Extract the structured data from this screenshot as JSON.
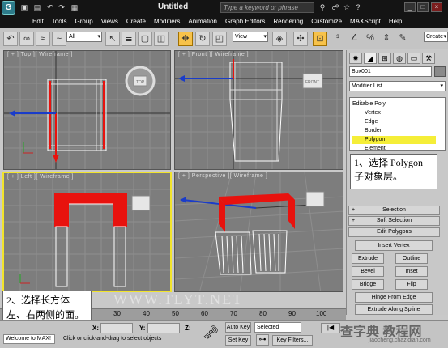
{
  "title": "Untitled",
  "search_placeholder": "Type a keyword or phrase",
  "menu": [
    "Edit",
    "Tools",
    "Group",
    "Views",
    "Create",
    "Modifiers",
    "Animation",
    "Graph Editors",
    "Rendering",
    "Customize",
    "MAXScript",
    "Help"
  ],
  "toolbar": {
    "filter": "All",
    "coord_system": "View",
    "named_set": "Create"
  },
  "viewports": {
    "top": "[ + ] Top ][ Wireframe ]",
    "front": "[ + ] Front ][ Wireframe ]",
    "left": "[ + ] Left ][ Wireframe ]",
    "perspective": "[ + ] Perspective ][ Wireframe ]",
    "viewcube_top": "TOP",
    "viewcube_front": "FRONT"
  },
  "command_panel": {
    "object_name": "Box001",
    "modifier_list": "Modifier List",
    "stack": [
      "Editable Poly",
      "Vertex",
      "Edge",
      "Border",
      "Polygon",
      "Element"
    ],
    "rollouts": [
      "Selection",
      "Soft Selection",
      "Edit Polygons"
    ],
    "buttons": {
      "insert_vertex": "Insert Vertex",
      "extrude": "Extrude",
      "outline": "Outline",
      "bevel": "Bevel",
      "inset": "Inset",
      "bridge": "Bridge",
      "flip": "Flip",
      "hinge": "Hinge From Edge",
      "extrude_spline": "Extrude Along Spline"
    }
  },
  "callouts": {
    "one_a": "1、选择 Polygon",
    "one_b": "子对象层。",
    "two_a": "2、选择长方体",
    "two_b": "左、右两侧的面。"
  },
  "watermark": "WWW.TLYT.NET",
  "time_ticks": [
    "30",
    "40",
    "50",
    "60",
    "70",
    "80",
    "90",
    "100"
  ],
  "status": {
    "script": "Welcome to MAX!",
    "prompt": "Click or click-and-drag to select objects",
    "x_label": "X:",
    "y_label": "Y:",
    "z_label": "Z:",
    "auto_key": "Auto Key",
    "selected": "Selected",
    "set_key": "Set Key",
    "key_filters": "Key Filters..."
  },
  "brand": "查字典 教程网",
  "brand_sub": "jiaocheng.chazidian.com",
  "colors": {
    "accent": "#f2e42b",
    "selection": "#e8120e",
    "dark_bar": "#141414"
  }
}
